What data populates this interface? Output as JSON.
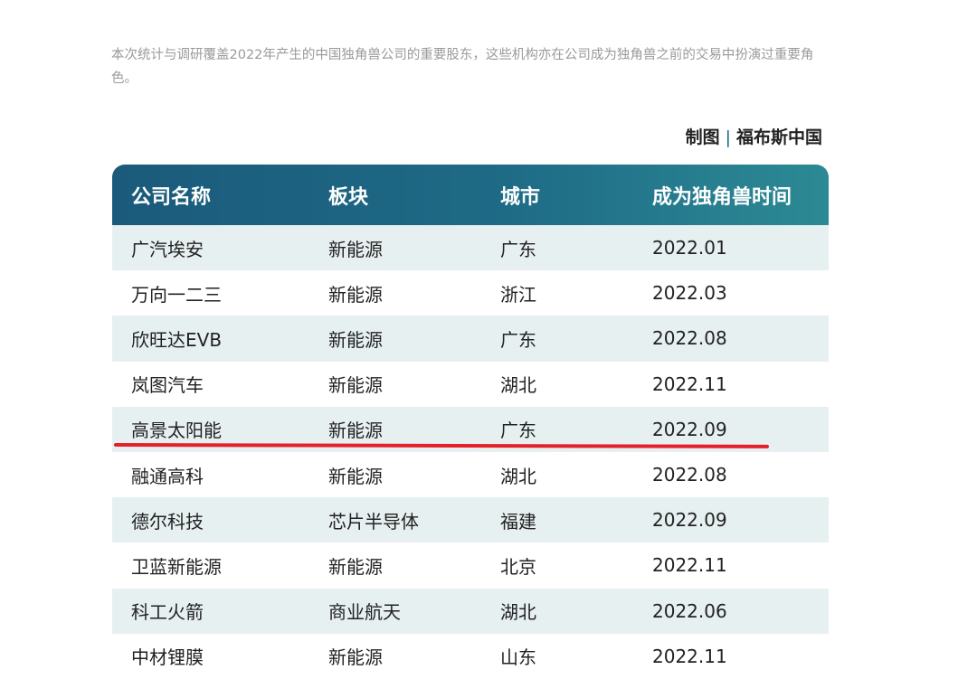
{
  "intro_text": "本次统计与调研覆盖2022年产生的中国独角兽公司的重要股东，这些机构亦在公司成为独角兽之前的交易中扮演过重要角色。",
  "credit": {
    "label": "制图",
    "separator": "|",
    "source": "福布斯中国"
  },
  "table": {
    "headers": [
      "公司名称",
      "板块",
      "城市",
      "成为独角兽时间"
    ],
    "rows": [
      [
        "广汽埃安",
        "新能源",
        "广东",
        "2022.01"
      ],
      [
        "万向一二三",
        "新能源",
        "浙江",
        "2022.03"
      ],
      [
        "欣旺达EVB",
        "新能源",
        "广东",
        "2022.08"
      ],
      [
        "岚图汽车",
        "新能源",
        "湖北",
        "2022.11"
      ],
      [
        "高景太阳能",
        "新能源",
        "广东",
        "2022.09"
      ],
      [
        "融通高科",
        "新能源",
        "湖北",
        "2022.08"
      ],
      [
        "德尔科技",
        "芯片半导体",
        "福建",
        "2022.09"
      ],
      [
        "卫蓝新能源",
        "新能源",
        "北京",
        "2022.11"
      ],
      [
        "科工火箭",
        "商业航天",
        "湖北",
        "2022.06"
      ],
      [
        "中材锂膜",
        "新能源",
        "山东",
        "2022.11"
      ]
    ]
  },
  "highlight": {
    "color": "#e4202a",
    "row_index": 4
  },
  "colors": {
    "header_start": "#1b5a7b",
    "header_end": "#2c8a94",
    "row_alt": "#e7f0f1"
  }
}
